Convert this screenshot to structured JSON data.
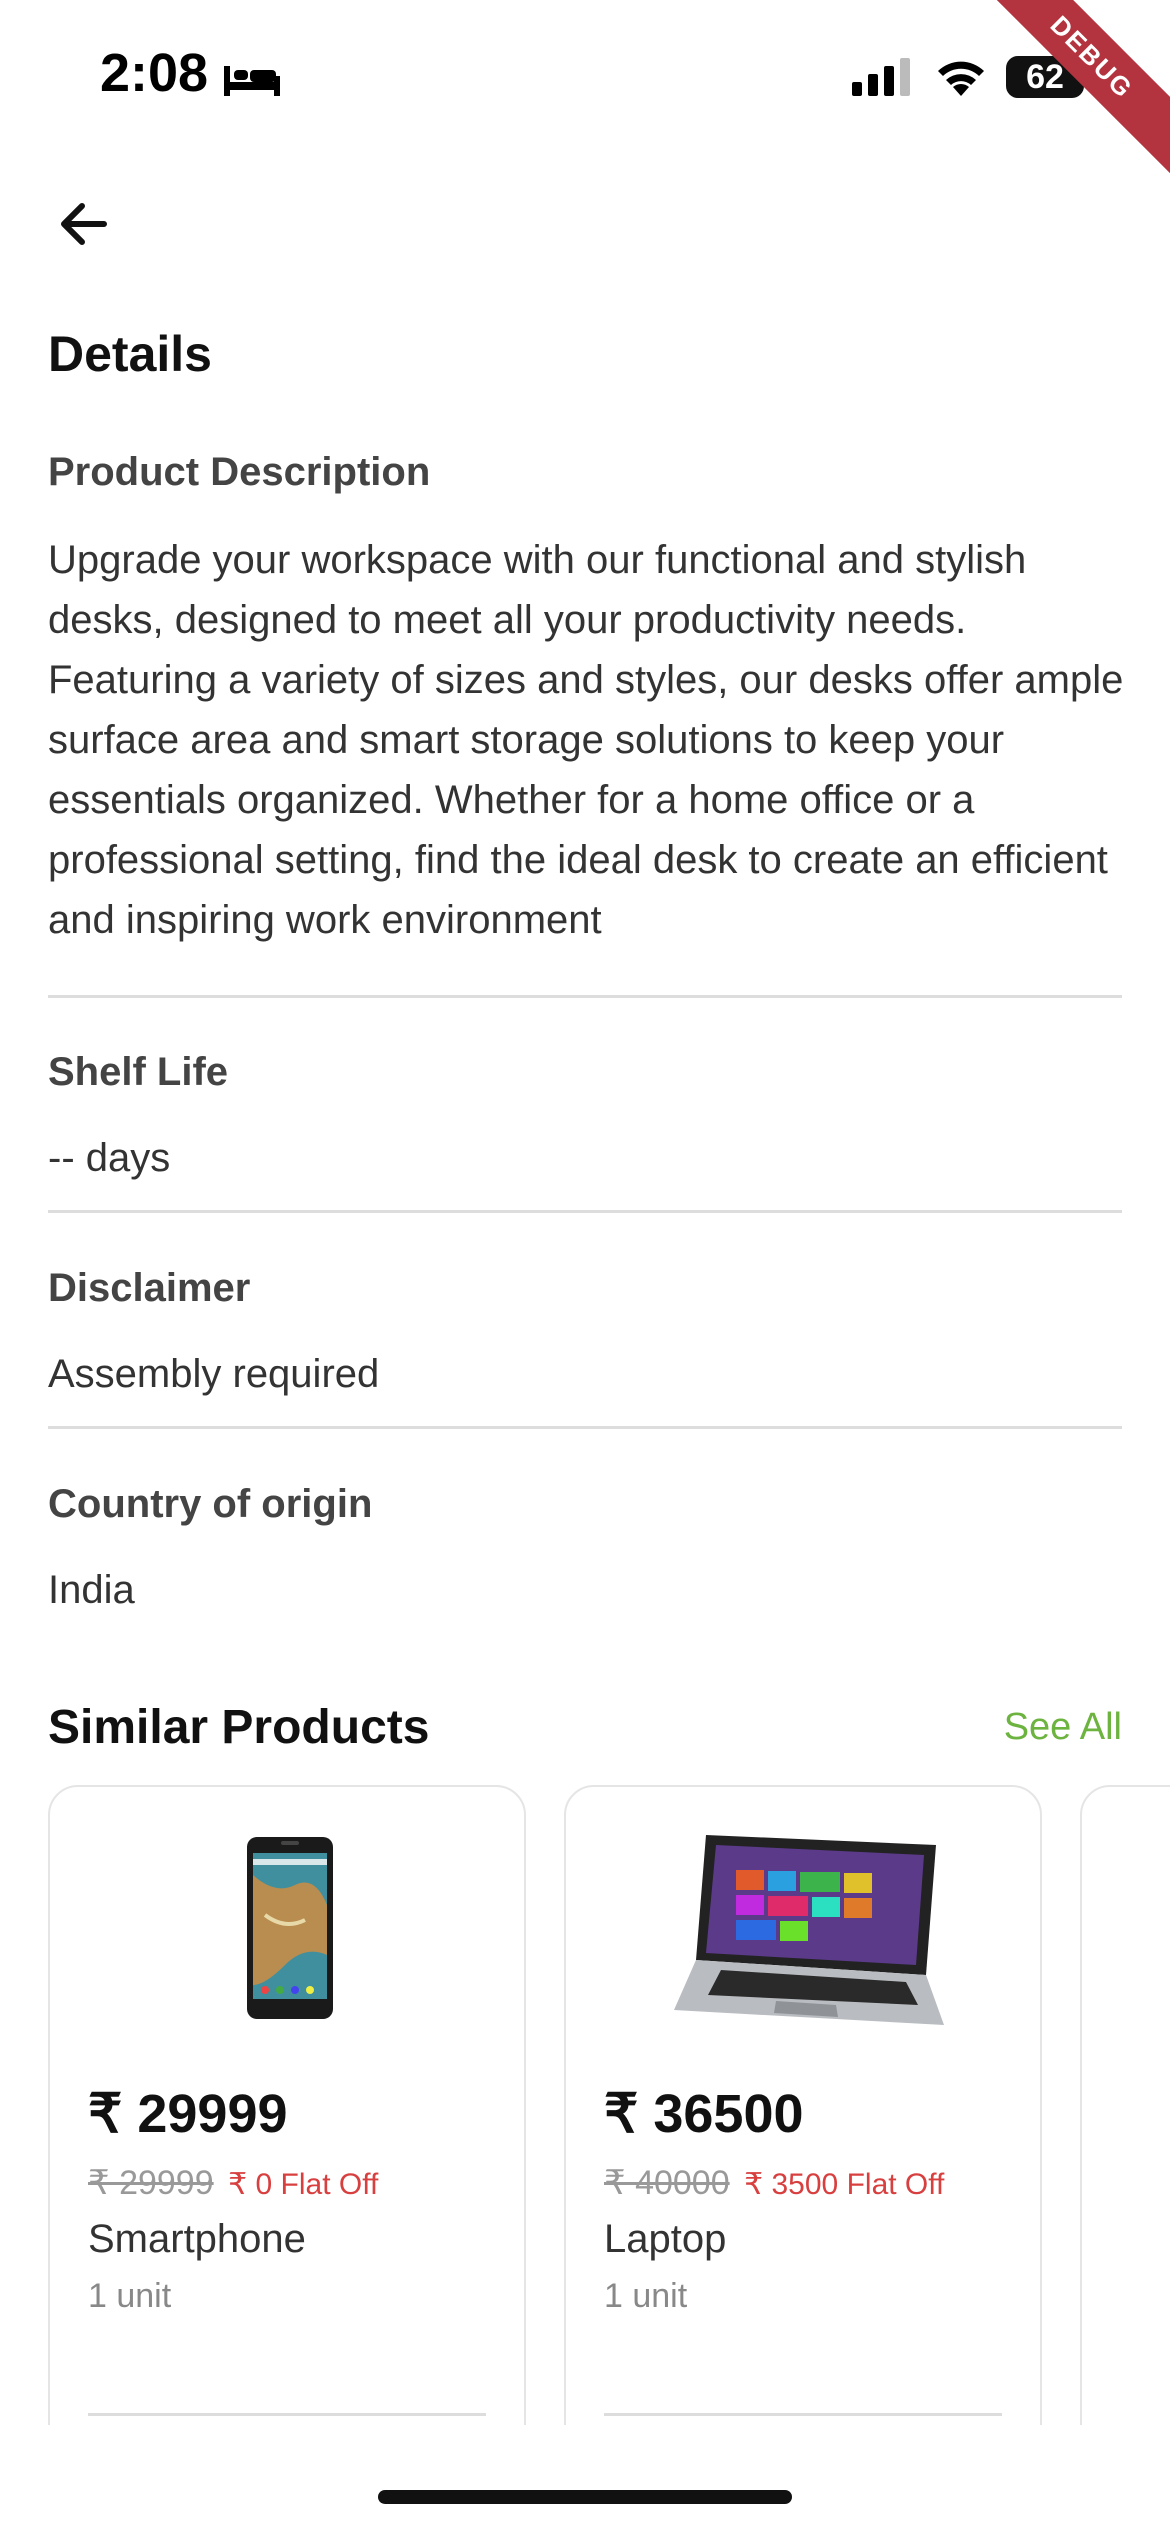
{
  "status_bar": {
    "time": "2:08",
    "battery": "62"
  },
  "debug_banner": "DEBUG",
  "header": {
    "title": "Details"
  },
  "sections": {
    "description": {
      "heading": "Product Description",
      "text": "Upgrade your workspace with our functional and stylish desks, designed to meet all your productivity needs. Featuring a variety of sizes and styles, our desks offer ample surface area and smart storage solutions to keep your essentials organized. Whether for a home office or a professional setting, find the ideal desk to create an efficient and inspiring work environment"
    },
    "shelf_life": {
      "heading": "Shelf Life",
      "text": "-- days"
    },
    "disclaimer": {
      "heading": "Disclaimer",
      "text": "Assembly required"
    },
    "origin": {
      "heading": "Country of origin",
      "text": "India"
    }
  },
  "similar": {
    "title": "Similar Products",
    "see_all": "See All",
    "products": [
      {
        "price": "₹ 29999",
        "old_price": "₹ 29999",
        "discount": "₹ 0 Flat Off",
        "name": "Smartphone",
        "unit": "1 unit"
      },
      {
        "price": "₹ 36500",
        "old_price": "₹ 40000",
        "discount": "₹ 3500 Flat Off",
        "name": "Laptop",
        "unit": "1 unit"
      }
    ]
  },
  "colors": {
    "accent": "#6db33f",
    "discount": "#d84040",
    "debug": "#b3343f"
  }
}
